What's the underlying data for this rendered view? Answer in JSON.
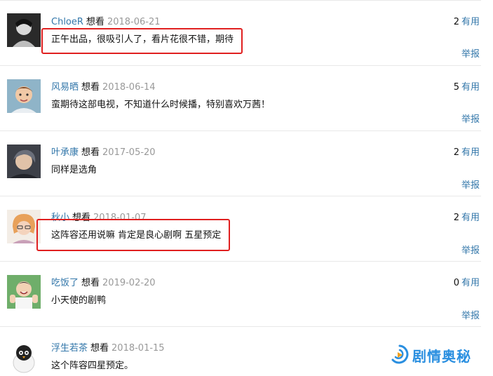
{
  "comments": [
    {
      "username": "ChloeR",
      "status": "想看",
      "date": "2018-06-21",
      "votes": "2",
      "useful_label": "有用",
      "content": "正午出品，很吸引人了，看片花很不错，期待",
      "report_label": "举报"
    },
    {
      "username": "风易晒",
      "status": "想看",
      "date": "2018-06-14",
      "votes": "5",
      "useful_label": "有用",
      "content": "蛮期待这部电视，不知道什么时候播，特别喜欢万茜！",
      "report_label": "举报"
    },
    {
      "username": "叶承康",
      "status": "想看",
      "date": "2017-05-20",
      "votes": "2",
      "useful_label": "有用",
      "content": "同样是选角",
      "report_label": "举报"
    },
    {
      "username": "秋小",
      "status": "想看",
      "date": "2018-01-07",
      "votes": "2",
      "useful_label": "有用",
      "content": "这阵容还用说嘛 肯定是良心剧啊 五星预定",
      "report_label": "举报"
    },
    {
      "username": "吃饭了",
      "status": "想看",
      "date": "2019-02-20",
      "votes": "0",
      "useful_label": "有用",
      "content": "小天使的剧鸭",
      "report_label": "举报"
    },
    {
      "username": "浮生若茶",
      "status": "想看",
      "date": "2018-01-15",
      "votes": "",
      "useful_label": "",
      "content": "这个阵容四星预定。",
      "report_label": ""
    }
  ],
  "watermark": {
    "text": "剧情奥秘",
    "accent": "#2a8fe0"
  },
  "colors": {
    "link": "#3377aa",
    "highlight": "#e02020",
    "date": "#999999"
  }
}
